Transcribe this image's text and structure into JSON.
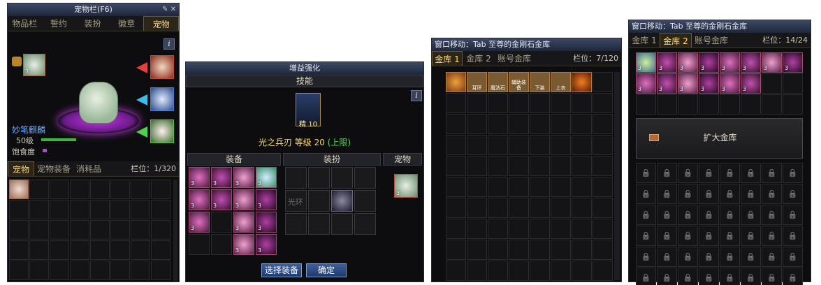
{
  "pet_window": {
    "title": "宠物栏(F6)",
    "tabs": [
      "物品栏",
      "誓约",
      "装扮",
      "徽章",
      "宠物"
    ],
    "active_tab": "宠物",
    "pet_name": "妙笔麒麟",
    "level": "50级",
    "satiety_label": "饱食度",
    "sub_tabs": [
      "宠物",
      "宠物装备",
      "消耗品"
    ],
    "slot_count": "栏位：1/320",
    "info": "i"
  },
  "enhance_window": {
    "title": "增益强化",
    "skill_header": "技能",
    "skill_badge": "精 10",
    "skill_text": "光之兵刃 等级 20",
    "skill_limit": "(上限)",
    "section_equip": "装备",
    "section_avatar": "装扮",
    "section_pet": "宠物",
    "avatar_empty": "光环",
    "select_button": "选择装备",
    "confirm_button": "确定",
    "info": "i"
  },
  "vault1": {
    "title": "窗口移动：Tab  至尊的金刚石金库",
    "tabs": [
      "金库 1",
      "金库 2",
      "账号金库"
    ],
    "slot_count": "栏位：7/120",
    "item_labels": [
      "",
      "耳环",
      "魔法石",
      "辅助装备",
      "下装",
      "上衣",
      ""
    ]
  },
  "vault2": {
    "title": "窗口移动：Tab  至尊的金刚石金库",
    "tabs": [
      "金库 1",
      "金库 2",
      "账号金库"
    ],
    "slot_count": "栏位：14/24",
    "expand_button": "扩大金库"
  },
  "colors": {
    "gold": "#ffcc66",
    "green": "#4ddc4d",
    "accent": "#3d5f9a"
  }
}
